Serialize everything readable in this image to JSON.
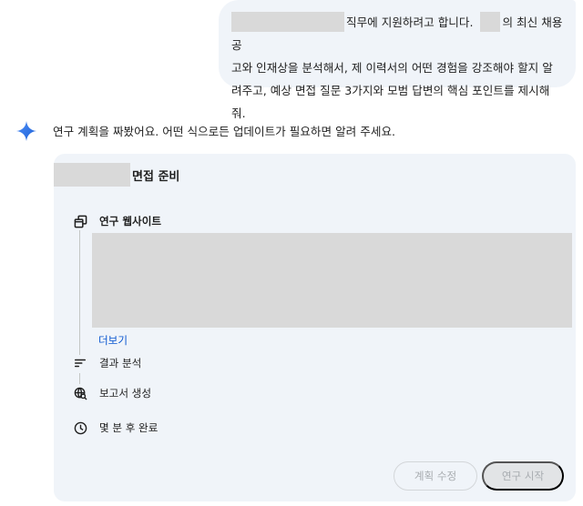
{
  "user_message": {
    "line1_after_redact": "직무에 지원하려고 합니다. ",
    "line1_end": "의 최신 채용 공",
    "line2": "고와 인재상을 분석해서, 제 이력서의 어떤 경험을 강조해야 할지 알",
    "line3": "려주고, 예상 면접 질문 3가지와 모범 답변의 핵심 포인트를 제시해줘."
  },
  "assistant": {
    "reply_text": "연구 계획을 짜봤어요. 어떤 식으로든 업데이트가 필요하면 알려 주세요."
  },
  "plan_card": {
    "title_suffix": "면접 준비",
    "steps": {
      "research_label": "연구 웹사이트",
      "more_label": "더보기",
      "analyze_label": "결과 분석",
      "report_label": "보고서 생성",
      "eta_label": "몇 분 후 완료"
    },
    "buttons": {
      "edit_label": "계획 수정",
      "start_label": "연구 시작"
    }
  },
  "icons": {
    "assistant": "sparkle-icon",
    "research": "browser-windows-icon",
    "analyze": "sort-lines-icon",
    "report": "globe-search-icon",
    "eta": "clock-icon"
  },
  "colors": {
    "bubble_bg": "#f0f4f9",
    "card_bg": "#f0f4f9",
    "link": "#0b57d0",
    "sparkle_start": "#4285f4",
    "sparkle_end": "#1a73e8"
  }
}
